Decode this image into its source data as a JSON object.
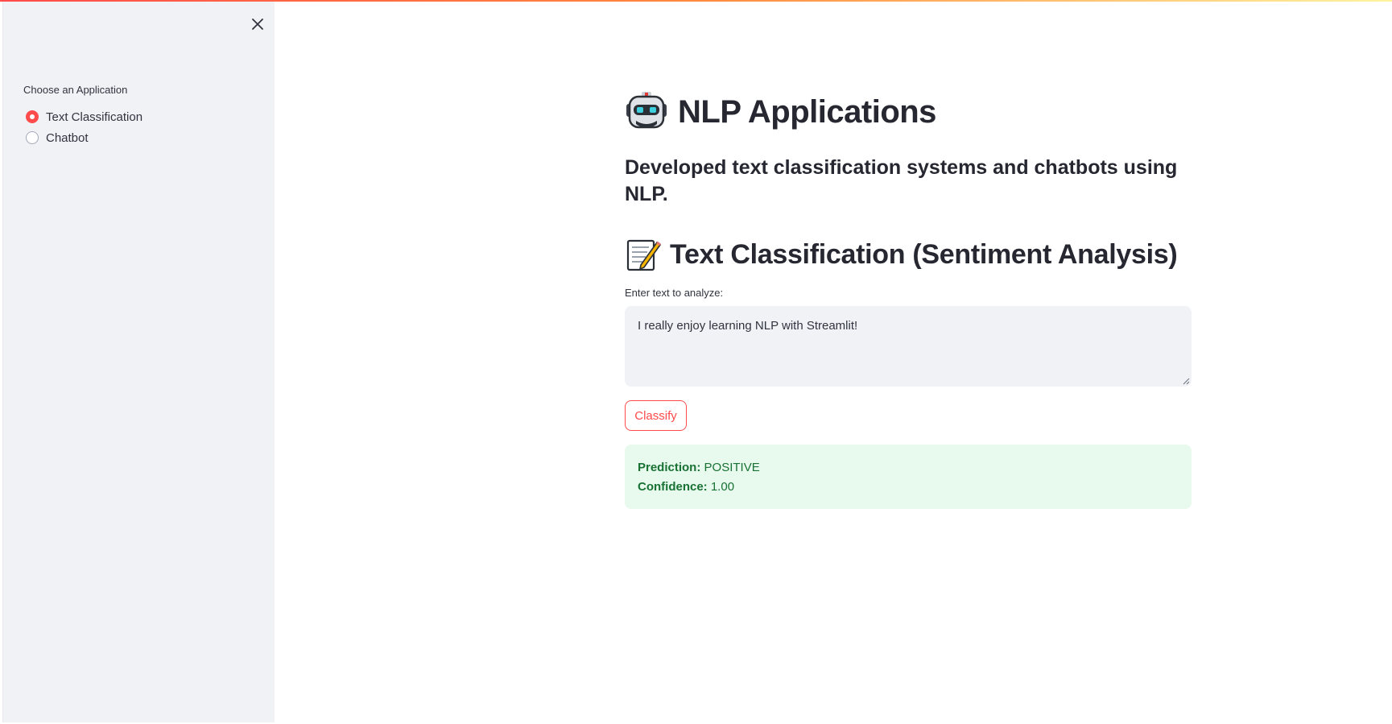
{
  "theme": {
    "accent": "#ff4b4b",
    "sidebar_bg": "#f0f2f6",
    "success_bg": "#e8f9ee",
    "success_text": "#177233"
  },
  "sidebar": {
    "close_icon": "close-icon",
    "radio_label": "Choose an Application",
    "options": [
      {
        "label": "Text Classification",
        "selected": true
      },
      {
        "label": "Chatbot",
        "selected": false
      }
    ]
  },
  "main": {
    "title_icon": "robot-icon",
    "title": "NLP Applications",
    "subtitle": "Developed text classification systems and chatbots using NLP.",
    "section_icon": "memo-icon",
    "section_title": "Text Classification (Sentiment Analysis)",
    "input_label": "Enter text to analyze:",
    "input_value": "I really enjoy learning NLP with Streamlit!",
    "classify_label": "Classify",
    "result": {
      "prediction_label": "Prediction:",
      "prediction_value": "POSITIVE",
      "confidence_label": "Confidence:",
      "confidence_value": "1.00"
    }
  }
}
